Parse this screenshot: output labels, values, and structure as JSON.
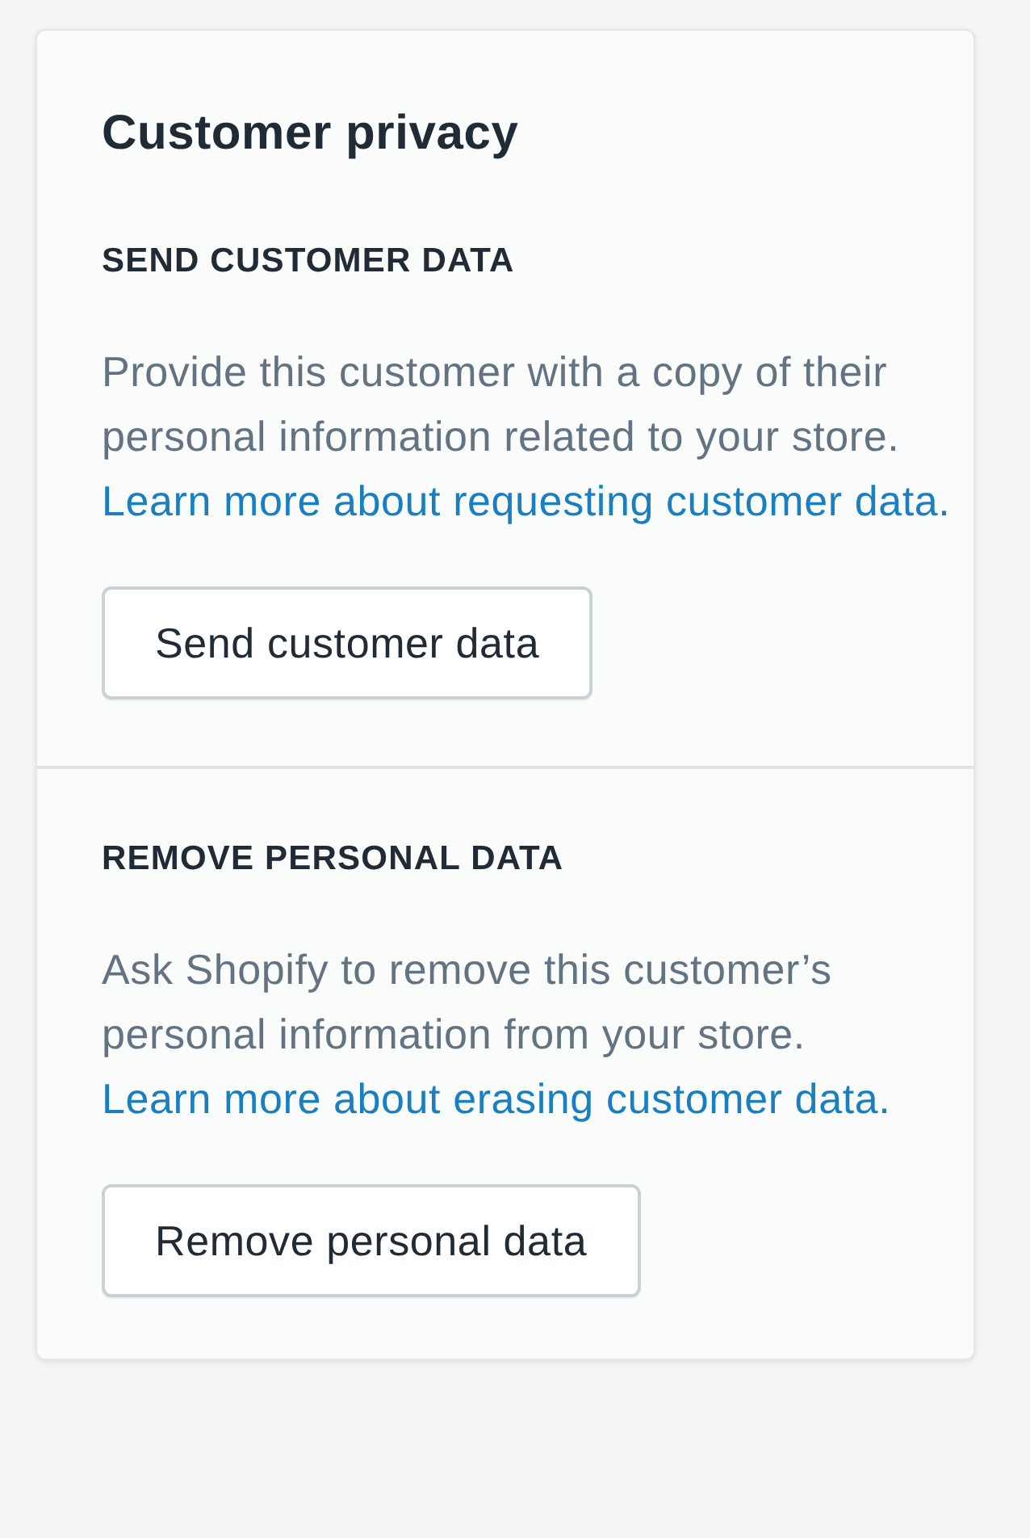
{
  "card": {
    "title": "Customer privacy",
    "sections": [
      {
        "heading": "SEND CUSTOMER DATA",
        "description": "Provide this customer with a copy of their personal information related to your store.",
        "link": "Learn more about requesting customer data.",
        "button": "Send customer data"
      },
      {
        "heading": "REMOVE PERSONAL DATA",
        "description": "Ask Shopify to remove this customer’s personal information from your store.",
        "link": "Learn more about erasing customer data.",
        "button": "Remove personal data"
      }
    ]
  }
}
